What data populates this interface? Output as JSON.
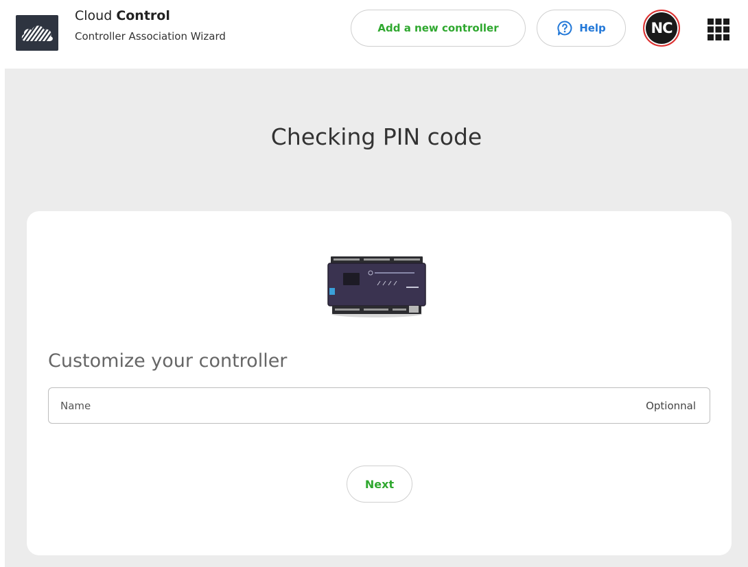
{
  "header": {
    "brand_name_prefix": "Cloud ",
    "brand_name_bold": "Control",
    "brand_subtitle": "Controller Association Wizard",
    "logo_icon": "cloud-logo-icon",
    "add_controller_label": "Add a new controller",
    "help_label": "Help",
    "help_icon": "question-bubble-icon",
    "avatar_initials": "NC",
    "apps_icon": "apps-grid-icon"
  },
  "main": {
    "title": "Checking PIN code",
    "device_image": "controller-device-image",
    "section_title": "Customize your controller",
    "name_field": {
      "placeholder": "Name",
      "value": "",
      "hint": "Optionnal"
    },
    "next_label": "Next"
  },
  "colors": {
    "accent_green": "#2fa82f",
    "help_blue": "#2278d8",
    "avatar_ring": "#e03030",
    "page_background": "#ececec",
    "logo_background": "#2e3440"
  }
}
